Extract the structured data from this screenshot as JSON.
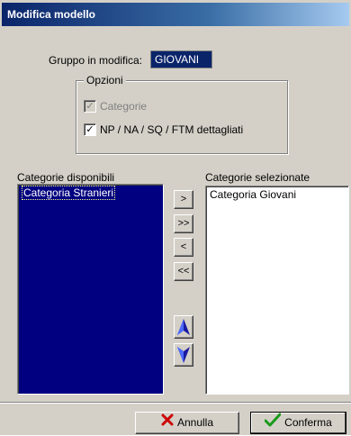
{
  "window": {
    "title": "Modifica modello"
  },
  "group": {
    "label": "Gruppo in modifica:",
    "value": "GIOVANI"
  },
  "options": {
    "title": "Opzioni",
    "categorie": {
      "label": "Categorie",
      "checked": true,
      "enabled": false
    },
    "dettagliati": {
      "label": "NP / NA / SQ / FTM dettagliati",
      "checked": true,
      "enabled": true
    }
  },
  "available": {
    "label": "Categorie disponibili",
    "items": [
      "Categoria Stranieri"
    ]
  },
  "selected": {
    "label": "Categorie selezionate",
    "items": [
      "Categoria Giovani"
    ]
  },
  "transfer_buttons": {
    "add": ">",
    "add_all": ">>",
    "remove": "<",
    "remove_all": "<<"
  },
  "move_buttons": {
    "up_icon": "arrow-up-icon",
    "down_icon": "arrow-down-icon"
  },
  "actions": {
    "cancel": "Annulla",
    "confirm": "Conferma"
  },
  "colors": {
    "selection": "#000080",
    "titlebar": "#0a246a",
    "face": "#d4d0c8",
    "cancel_icon": "#cc0000",
    "confirm_icon": "#1a9a1a"
  }
}
